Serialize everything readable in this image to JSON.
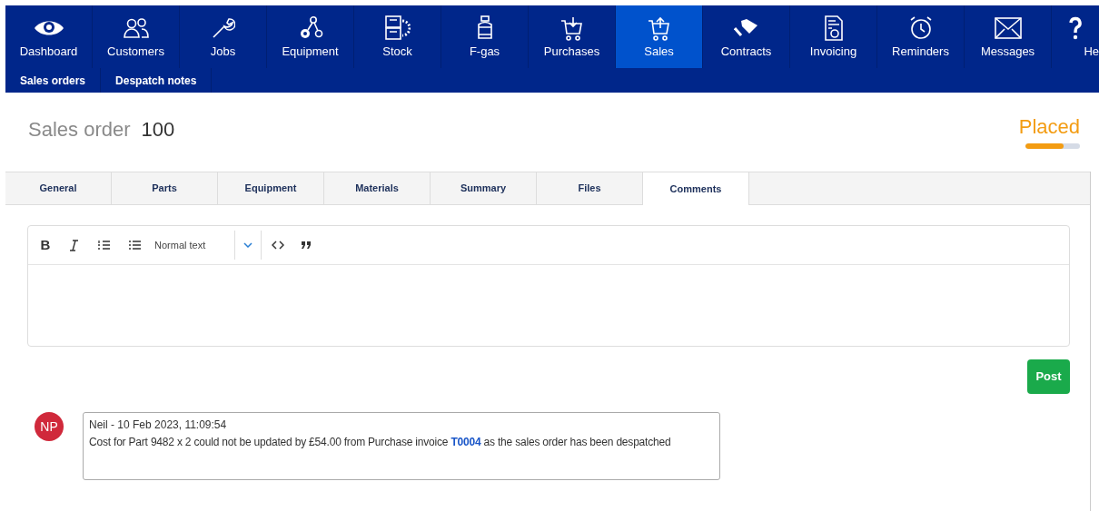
{
  "nav": {
    "items": [
      {
        "label": "Dashboard",
        "selected": false
      },
      {
        "label": "Customers",
        "selected": false
      },
      {
        "label": "Jobs",
        "selected": false
      },
      {
        "label": "Equipment",
        "selected": false
      },
      {
        "label": "Stock",
        "selected": false
      },
      {
        "label": "F-gas",
        "selected": false
      },
      {
        "label": "Purchases",
        "selected": false
      },
      {
        "label": "Sales",
        "selected": true
      },
      {
        "label": "Contracts",
        "selected": false
      },
      {
        "label": "Invoicing",
        "selected": false
      },
      {
        "label": "Reminders",
        "selected": false
      },
      {
        "label": "Messages",
        "selected": false
      },
      {
        "label": "He",
        "selected": false
      }
    ],
    "sub_items": [
      "Sales orders",
      "Despatch notes"
    ]
  },
  "header": {
    "title": "Sales order",
    "number": "100",
    "status": "Placed",
    "status_level": {
      "level": 0.7
    }
  },
  "tabs": [
    {
      "label": "General",
      "selected": false
    },
    {
      "label": "Parts",
      "selected": false
    },
    {
      "label": "Equipment",
      "selected": false
    },
    {
      "label": "Materials",
      "selected": false
    },
    {
      "label": "Summary",
      "selected": false
    },
    {
      "label": "Files",
      "selected": false
    },
    {
      "label": "Comments",
      "selected": true
    }
  ],
  "editor": {
    "bold_label": "B",
    "format": "Normal text"
  },
  "post_button": "Post",
  "comments": [
    {
      "initials": "NP",
      "meta": "Neil - 10 Feb 2023, 11:09:54",
      "text_before": "Cost for Part 9482 x 2 could not be updated by £54.00 from Purchase invoice",
      "link": "T0004",
      "text_after": "as the sales order has been despatched"
    }
  ]
}
